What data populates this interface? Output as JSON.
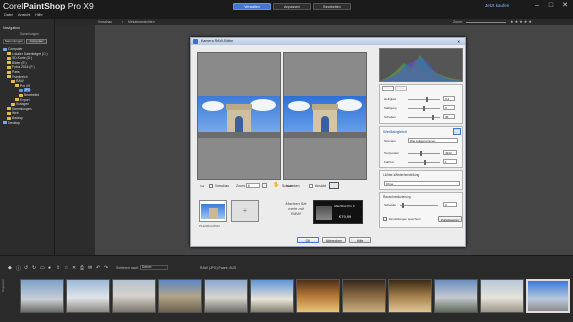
{
  "app": {
    "title_light": "Corel",
    "title_bold": "PaintShop",
    "title_rest": "Pro X9"
  },
  "window_buttons": [
    "–",
    "□",
    "✕"
  ],
  "menu": [
    "Datei",
    "Ansicht",
    "Hilfe"
  ],
  "workspace_tabs": [
    {
      "label": "Verwalten",
      "active": true
    },
    {
      "label": "Anpassen",
      "active": false
    },
    {
      "label": "Bearbeiten",
      "active": false
    }
  ],
  "brand": "Jetzt kaufen",
  "subtoolbar": {
    "preview": "Vorschau",
    "path": "Miniaturansichten",
    "zoom_label": "Zoom:"
  },
  "leftpanel": {
    "title": "Navigation",
    "subtitle": "Sammlungen",
    "tabs": [
      "Sammlungen",
      "Computer"
    ],
    "tree": [
      "Computer",
      "Lokaler Datenträger (C:)",
      "SD-Karte (D:)",
      "Bilder (E:)",
      "Fotos 2016 (F:)",
      "Paris",
      "Frankreich",
      "RAW",
      "Pro X9",
      "JPG",
      "Bearbeitet",
      "Export",
      "Vorlagen",
      "Sammlungen",
      "Web",
      "Backup",
      "Desktop"
    ]
  },
  "dialog": {
    "title": "Kamera RAW-Editor",
    "before_label": "Vor",
    "after_label": "Nach",
    "preview_checkbox": "Vorschau",
    "zoom_label": "Zoom:",
    "zoom_value": "6",
    "rotate_label": "Schwenken",
    "info_label": "Ansicht",
    "promo_text": "Machen Sie mehr mit RAW!",
    "promo_product": "AfterShot Pro 3",
    "promo_price": "€79,99",
    "file_label": "P1120010.RW2",
    "tabs": [
      "Basis",
      "Linse"
    ],
    "adjust": [
      {
        "label": "Helligkeit",
        "value": "0,2"
      },
      {
        "label": "Sättigung",
        "value": "0"
      },
      {
        "label": "Schatten",
        "value": "35"
      }
    ],
    "wb": {
      "title": "Weißabgleich",
      "scene_label": "Szenario",
      "scene_value": "Wie Aufgenommen",
      "temperature_label": "Temperatur",
      "temperature_value": "4942",
      "tint_label": "Farbton",
      "tint_value": "1"
    },
    "highlight": {
      "title": "Lichter-Wiederherstellung",
      "value": "Ohne"
    },
    "noise": {
      "title": "Rauschreduzierung",
      "label": "Schwelle",
      "value": "0"
    },
    "save_checkbox": "Einstellungen speichern",
    "reset_button": "Zurücksetzen",
    "buttons": {
      "ok": "OK",
      "cancel": "Abbrechen",
      "help": "Hilfe"
    }
  },
  "filmstrip": {
    "sort_label": "Sortieren nach:",
    "sort_value": "Datum",
    "filter_label": "RAW (JPG) Paare: AUS",
    "side_label": "Organizer"
  },
  "colors": {
    "accent": "#3f78d0",
    "folder": "#e8b84a",
    "dialog_bg": "#ececec"
  }
}
